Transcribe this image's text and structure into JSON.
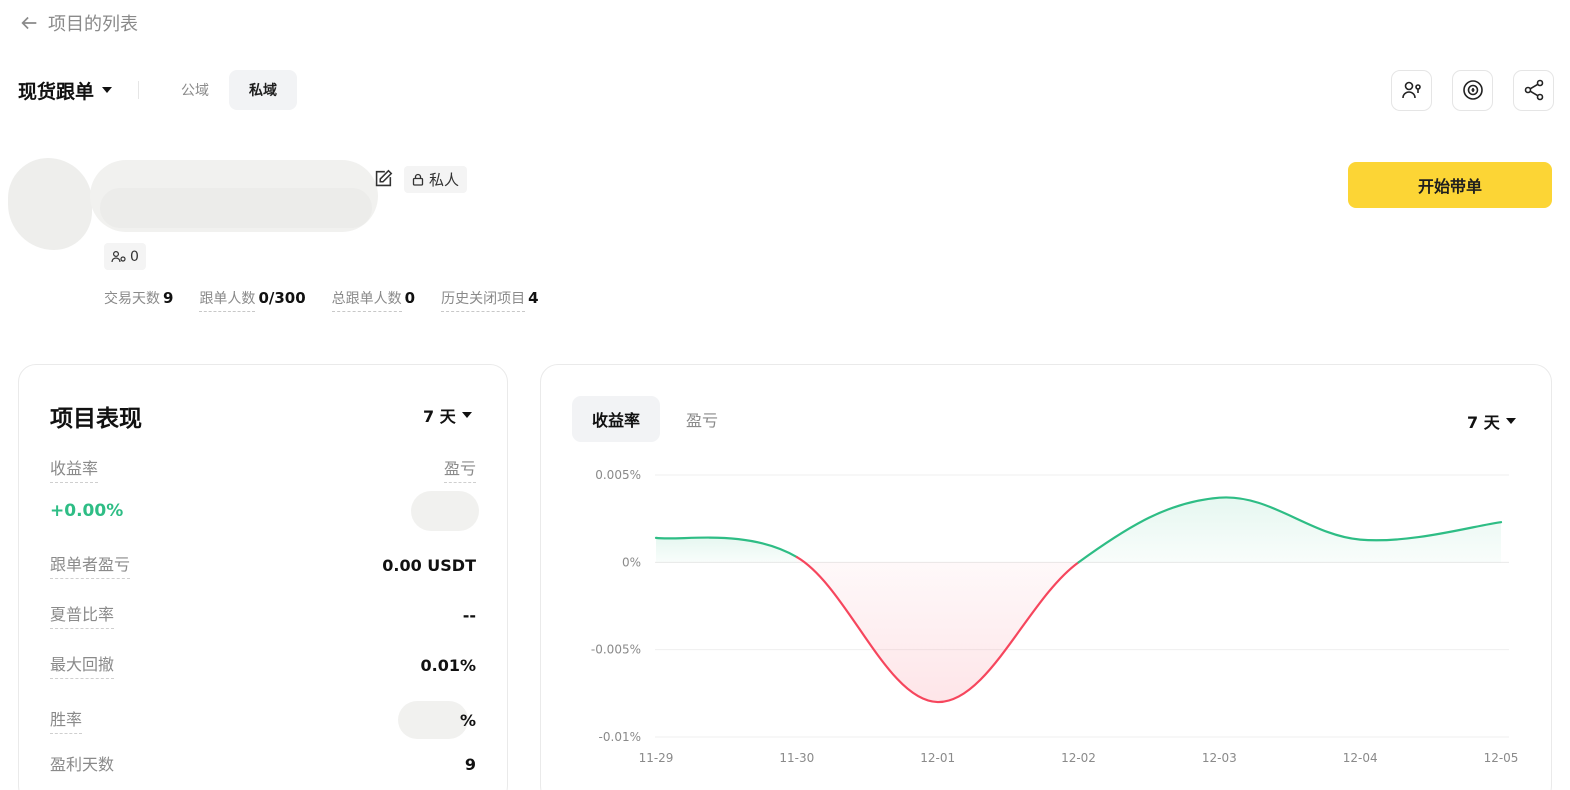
{
  "nav": {
    "back_label": "项目的列表"
  },
  "header": {
    "mode_label": "现货跟单",
    "tabs": [
      {
        "label": "公域"
      },
      {
        "label": "私域"
      }
    ],
    "icons": [
      "user-settings-icon",
      "copy-coin-icon",
      "share-icon"
    ]
  },
  "profile": {
    "private_badge": "私人",
    "follower_count": "0",
    "stats": [
      {
        "label": "交易天数",
        "value": "9"
      },
      {
        "label": "跟单人数",
        "value": "0/300"
      },
      {
        "label": "总跟单人数",
        "value": "0"
      },
      {
        "label": "历史关闭项目",
        "value": "4"
      }
    ],
    "cta_label": "开始带单"
  },
  "performance": {
    "title": "项目表现",
    "period": "7 天",
    "roi_label": "收益率",
    "roi_value": "+0.00%",
    "pnl_label": "盈亏",
    "rows": [
      {
        "label": "跟单者盈亏",
        "value": "0.00 USDT"
      },
      {
        "label": "夏普比率",
        "value": "--"
      },
      {
        "label": "最大回撤",
        "value": "0.01%"
      },
      {
        "label": "胜率",
        "value": "%"
      },
      {
        "label": "盈利天数",
        "value": "9"
      }
    ]
  },
  "chart_panel": {
    "tabs": [
      {
        "label": "收益率"
      },
      {
        "label": "盈亏"
      }
    ],
    "period": "7 天"
  },
  "colors": {
    "accent": "#fcd535",
    "positive": "#2ebd85",
    "negative": "#f6465d"
  },
  "chart_data": {
    "type": "area",
    "categories": [
      "11-29",
      "11-30",
      "12-01",
      "12-02",
      "12-03",
      "12-04",
      "12-05"
    ],
    "values": [
      0.0014,
      0.0003,
      -0.008,
      0.0,
      0.0037,
      0.0013,
      0.0023
    ],
    "y_ticks": [
      "0.005%",
      "0%",
      "-0.005%",
      "-0.01%"
    ],
    "y_tick_values": [
      0.005,
      0,
      -0.005,
      -0.01
    ],
    "ylim": [
      -0.01,
      0.005
    ],
    "grid": true
  }
}
